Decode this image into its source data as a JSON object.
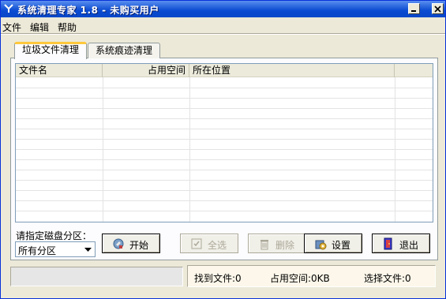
{
  "window": {
    "title": "系统清理专家 1.8 - 未购买用户",
    "title_bar_color": "#0a4ad2"
  },
  "menu": {
    "items": [
      {
        "label": "文件"
      },
      {
        "label": "编辑"
      },
      {
        "label": "帮助"
      }
    ]
  },
  "tabs": [
    {
      "label": "垃圾文件清理",
      "active": true
    },
    {
      "label": "系统痕迹清理",
      "active": false
    }
  ],
  "list": {
    "columns": [
      {
        "label": "文件名",
        "align": "left"
      },
      {
        "label": "占用空间",
        "align": "right"
      },
      {
        "label": "所在位置",
        "align": "left"
      },
      {
        "label": "",
        "align": "left"
      }
    ],
    "rows": []
  },
  "drive": {
    "label": "请指定磁盘分区：",
    "selected": "所有分区"
  },
  "buttons": [
    {
      "label": "开始",
      "icon": "start-icon",
      "enabled": true
    },
    {
      "label": "全选",
      "icon": "select-all-icon",
      "enabled": false
    },
    {
      "label": "删除",
      "icon": "trash-icon",
      "enabled": false
    },
    {
      "label": "设置",
      "icon": "settings-icon",
      "enabled": true
    },
    {
      "label": "退出",
      "icon": "exit-door-icon",
      "enabled": true
    }
  ],
  "status": {
    "found_files": "找到文件:0",
    "used_space": "占用空间:0KB",
    "selected_files": "选择文件:0"
  },
  "colors": {
    "tab_highlight": "#ffc83c",
    "face": "#ece9d8",
    "status_panel": "#fcf7ea"
  }
}
